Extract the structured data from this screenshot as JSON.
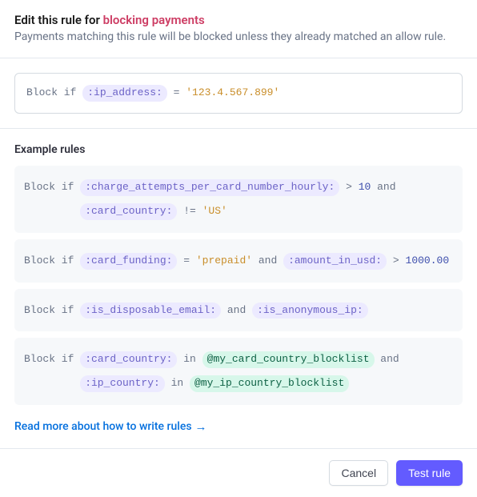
{
  "header": {
    "title_prefix": "Edit this rule for ",
    "title_ruletype": "blocking payments",
    "subtitle": "Payments matching this rule will be blocked unless they already matched an allow rule."
  },
  "editor": {
    "prefix": "Block if ",
    "variable": ":ip_address:",
    "operator": " = ",
    "value": "'123.4.567.899'"
  },
  "examples": {
    "heading": "Example rules",
    "rows": [
      {
        "prefix": "Block if ",
        "parts": [
          {
            "kind": "var",
            "text": ":charge_attempts_per_card_number_hourly:"
          },
          {
            "kind": "op",
            "text": " > "
          },
          {
            "kind": "num",
            "text": "10"
          },
          {
            "kind": "kw",
            "text": " and"
          },
          {
            "kind": "br"
          },
          {
            "kind": "var",
            "text": ":card_country:"
          },
          {
            "kind": "op",
            "text": " != "
          },
          {
            "kind": "str",
            "text": "'US'"
          }
        ]
      },
      {
        "prefix": "Block if ",
        "parts": [
          {
            "kind": "var",
            "text": ":card_funding:"
          },
          {
            "kind": "op",
            "text": " = "
          },
          {
            "kind": "str",
            "text": "'prepaid'"
          },
          {
            "kind": "kw",
            "text": " and "
          },
          {
            "kind": "var",
            "text": ":amount_in_usd:"
          },
          {
            "kind": "op",
            "text": " > "
          },
          {
            "kind": "num",
            "text": "1000.00"
          }
        ]
      },
      {
        "prefix": "Block if ",
        "parts": [
          {
            "kind": "var",
            "text": ":is_disposable_email:"
          },
          {
            "kind": "kw",
            "text": " and "
          },
          {
            "kind": "var",
            "text": ":is_anonymous_ip:"
          }
        ]
      },
      {
        "prefix": "Block if ",
        "parts": [
          {
            "kind": "var",
            "text": ":card_country:"
          },
          {
            "kind": "kw",
            "text": " in "
          },
          {
            "kind": "list",
            "text": "@my_card_country_blocklist"
          },
          {
            "kind": "kw",
            "text": " and"
          },
          {
            "kind": "br"
          },
          {
            "kind": "var",
            "text": ":ip_country:"
          },
          {
            "kind": "kw",
            "text": " in "
          },
          {
            "kind": "list",
            "text": "@my_ip_country_blocklist"
          }
        ]
      }
    ]
  },
  "read_more": "Read more about how to write rules",
  "footer": {
    "cancel": "Cancel",
    "test": "Test rule"
  }
}
